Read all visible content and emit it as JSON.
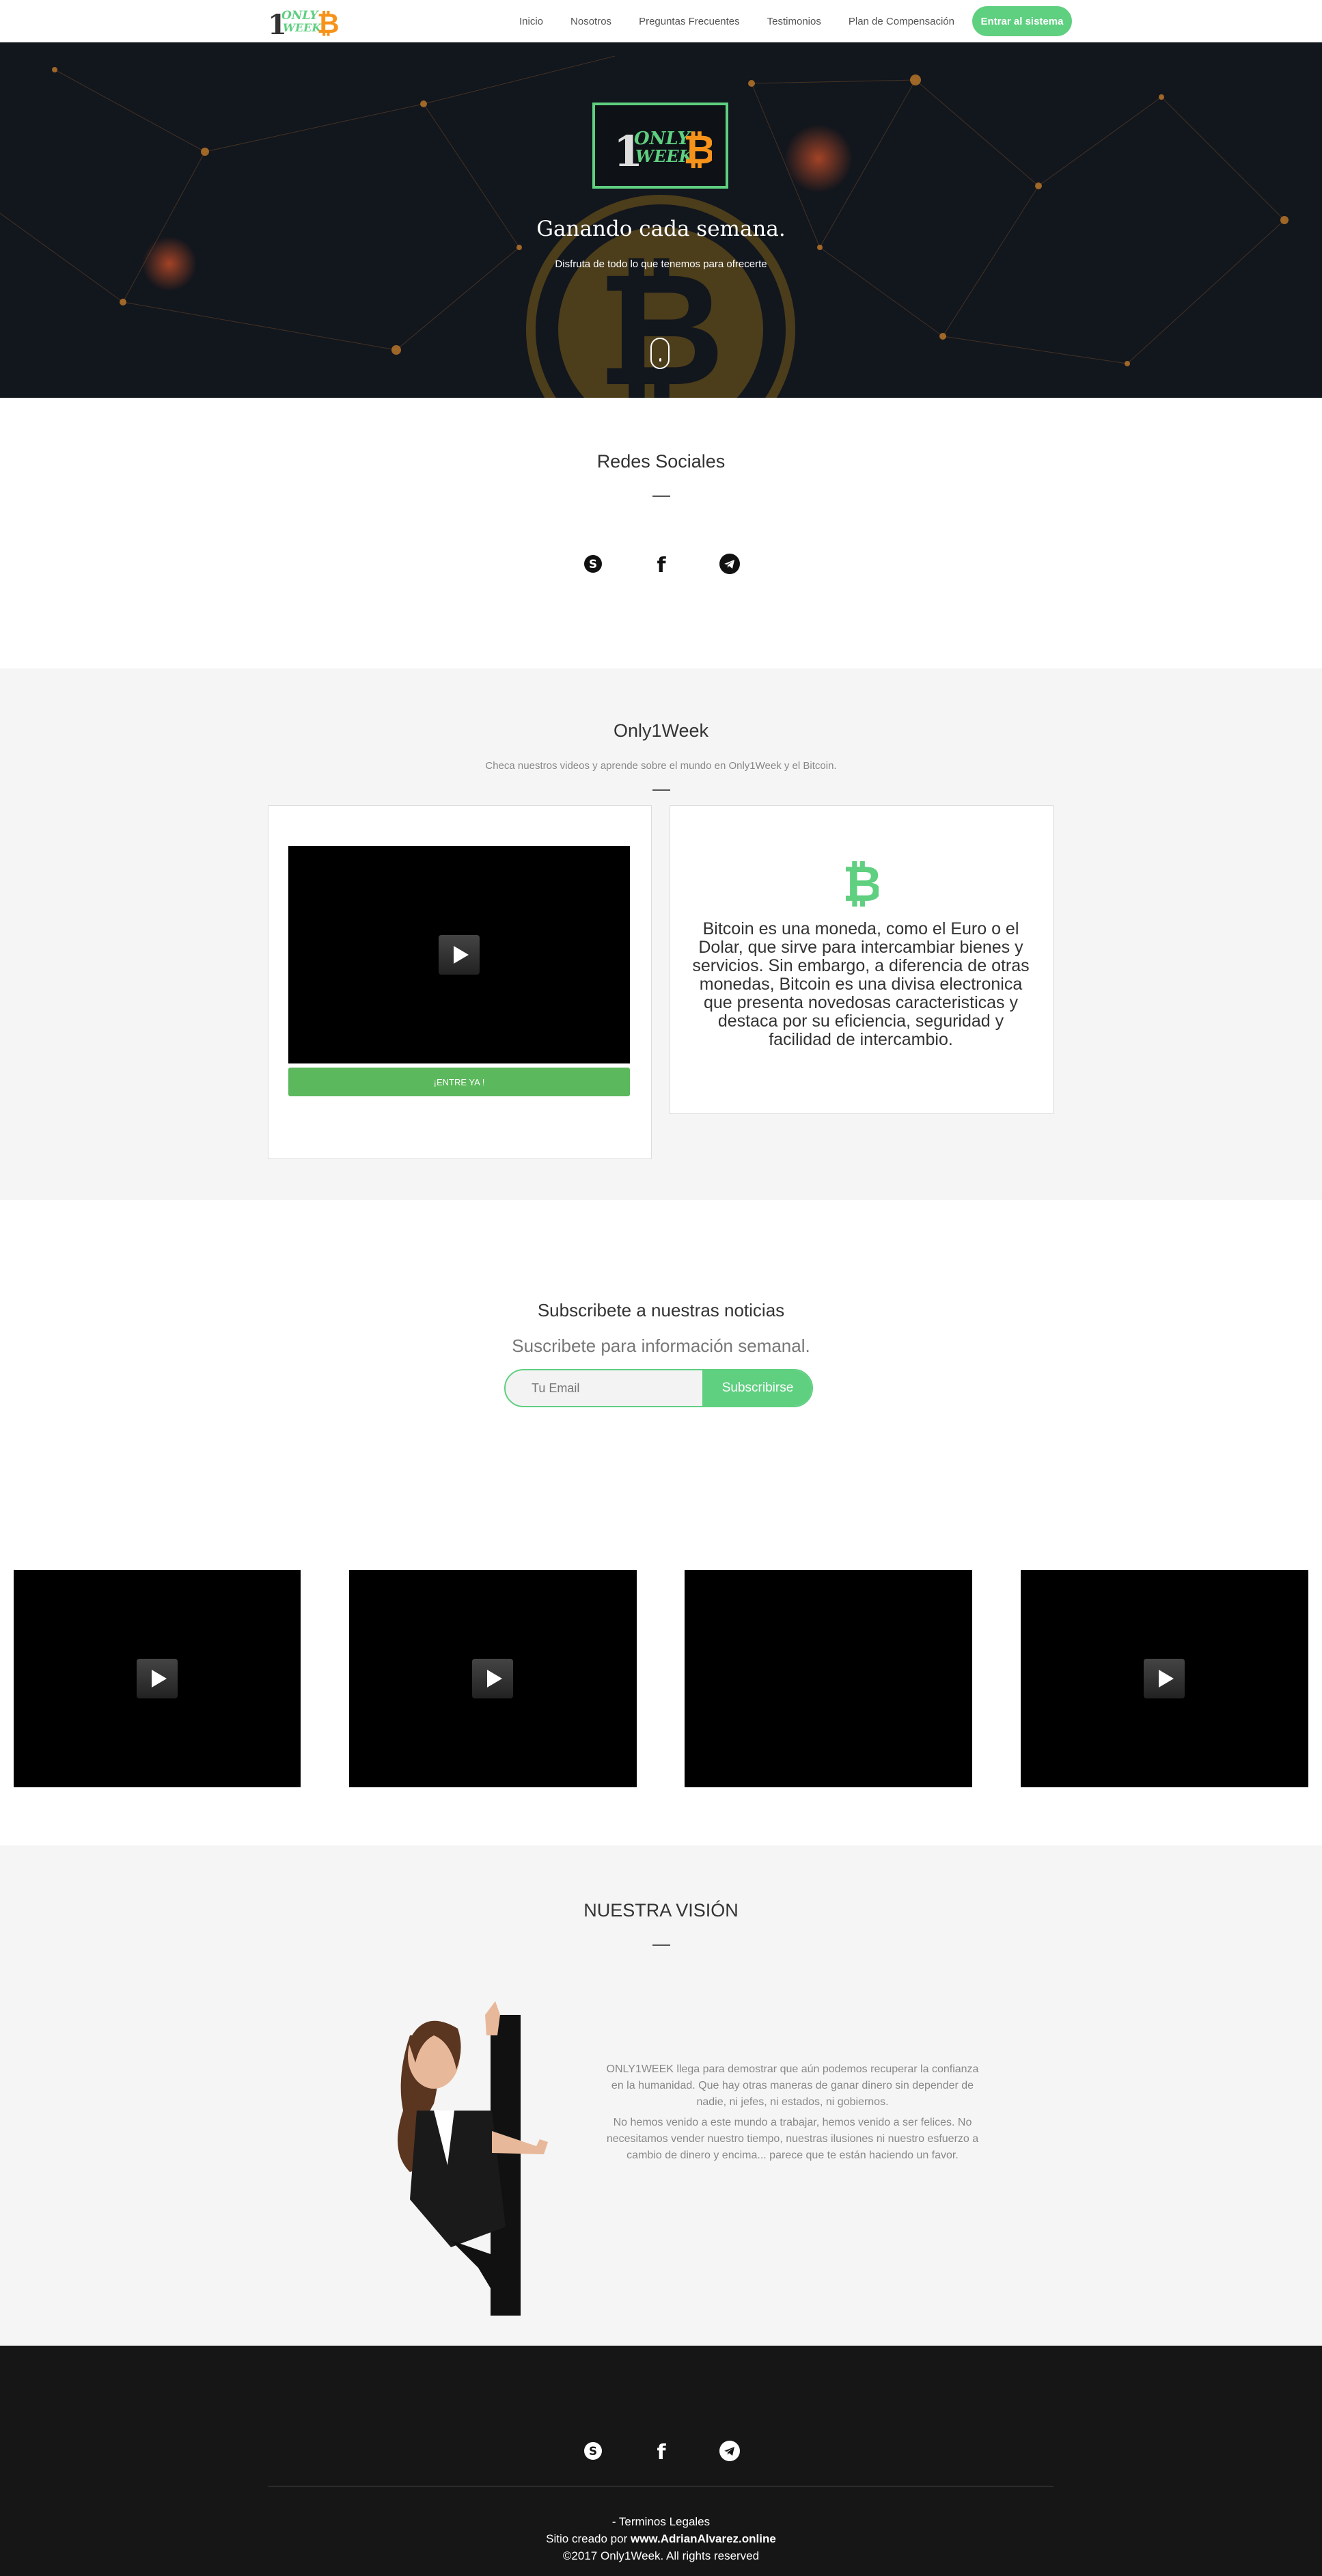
{
  "nav": {
    "logo_alt": "1 ONLY WEEK",
    "links": [
      "Inicio",
      "Nosotros",
      "Preguntas Frecuentes",
      "Testimonios",
      "Plan de Compensación"
    ],
    "cta": "Entrar al sistema"
  },
  "hero": {
    "title": "Ganando cada semana.",
    "subtitle": "Disfruta de todo lo que tenemos para ofrecerte"
  },
  "social": {
    "title": "Redes Sociales",
    "icons": [
      "skype-icon",
      "facebook-icon",
      "telegram-icon"
    ]
  },
  "about": {
    "title": "Only1Week",
    "description": "Checa nuestros videos y aprende sobre el mundo en Only1Week y el Bitcoin.",
    "button": "¡ENTRE YA !",
    "bitcoin_text": "Bitcoin es una moneda, como el Euro o el Dolar, que sirve para intercambiar bienes y servicios. Sin embargo, a diferencia de otras monedas, Bitcoin es una divisa electronica que presenta novedosas caracteristicas y destaca por su eficiencia, seguridad y facilidad de intercambio."
  },
  "subscribe": {
    "title": "Subscribete a nuestras noticias",
    "description": "Suscribete para información semanal.",
    "placeholder": "Tu Email",
    "button": "Subscribirse"
  },
  "videos_count_label": "",
  "vision": {
    "title": "NUESTRA VISIÓN",
    "paragraph1": "ONLY1WEEK llega para demostrar que aún podemos recuperar la confianza en la humanidad. Que hay otras maneras de ganar dinero sin depender de nadie, ni jefes, ni estados, ni gobiernos.",
    "paragraph2": "No hemos venido a este mundo a trabajar, hemos venido a ser felices. No necesitamos vender nuestro tiempo, nuestras ilusiones ni nuestro esfuerzo a cambio de dinero y encima... parece que te están haciendo un favor."
  },
  "footer": {
    "legal": "- Terminos Legales",
    "credit_prefix": "Sitio creado por ",
    "credit_link": "www.AdrianAlvarez.online",
    "copyright": "©2017 Only1Week. All rights reserved"
  },
  "colors": {
    "accent": "#5fcf80",
    "button_green": "#5cb85c",
    "bitcoin_orange": "#f7931a",
    "hero_bg": "#12161d",
    "footer_bg": "#161616"
  }
}
